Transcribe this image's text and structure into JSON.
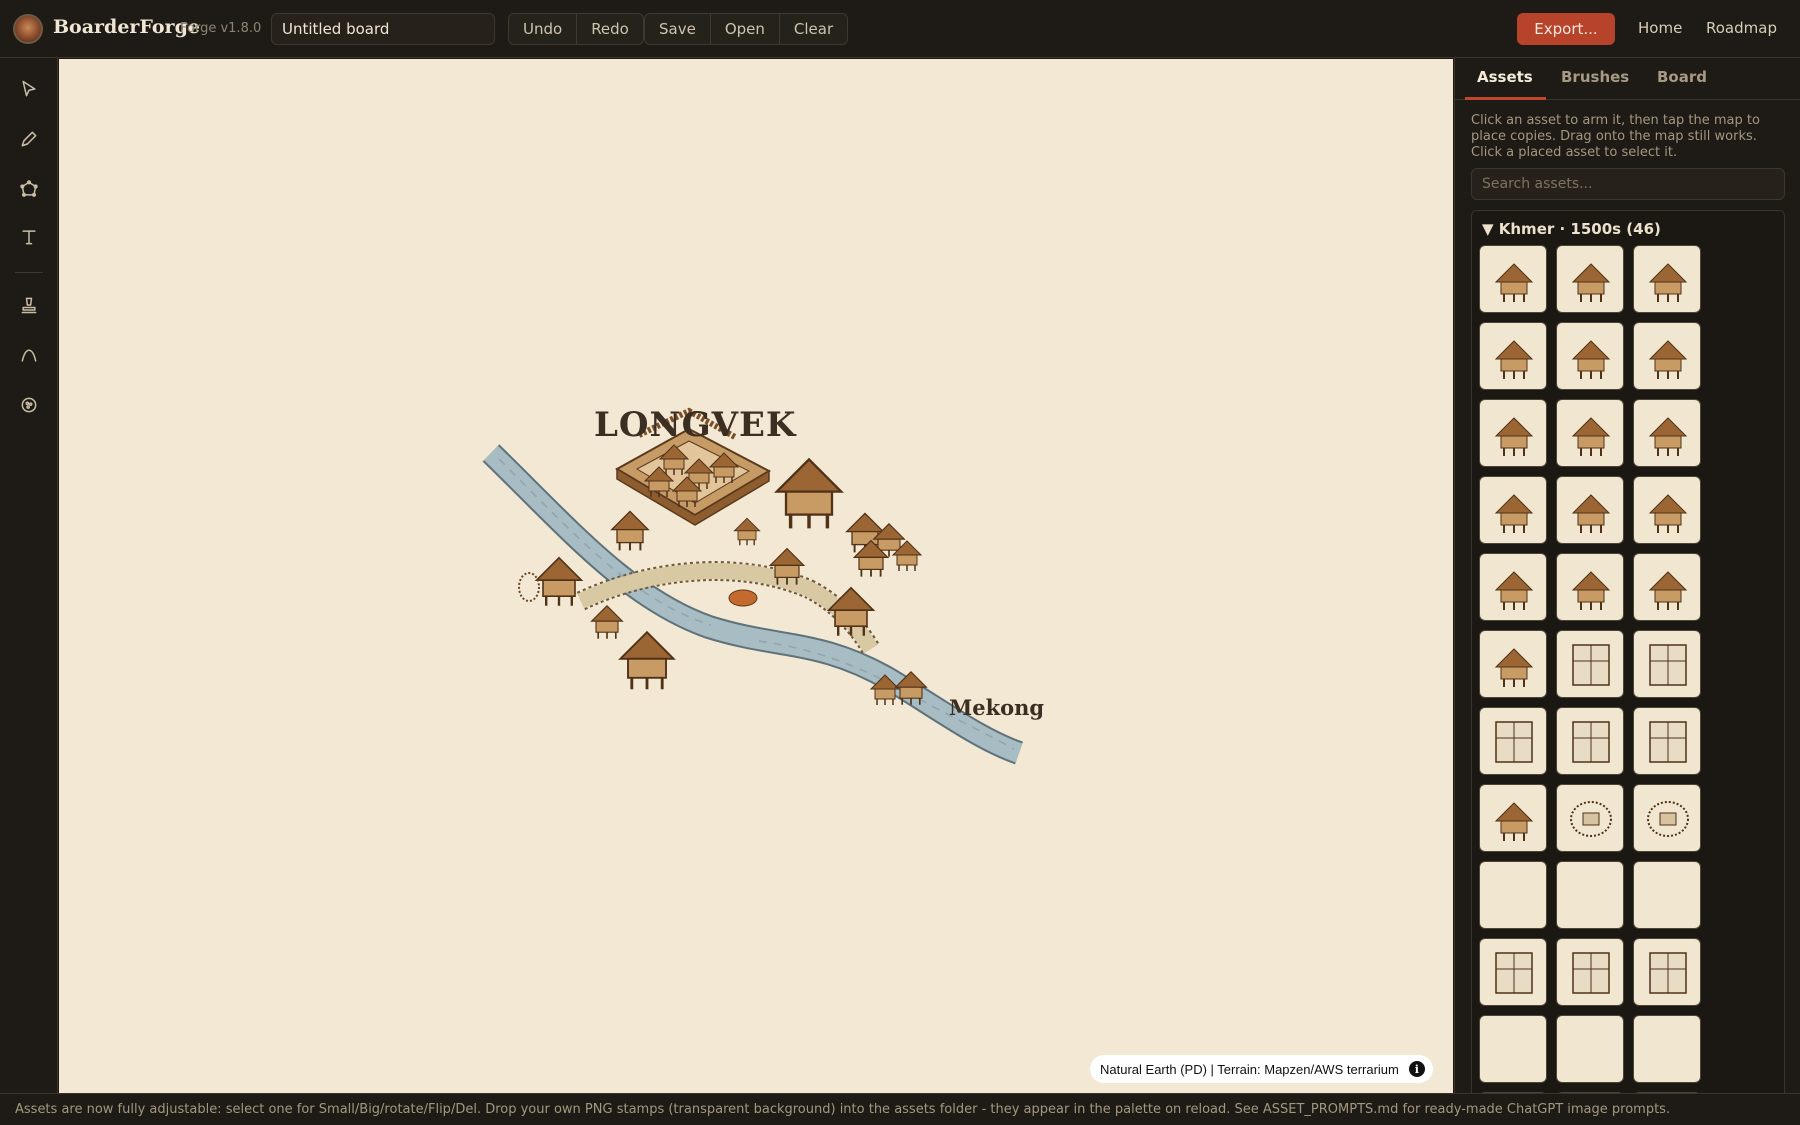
{
  "app": {
    "brand": "BoarderForge",
    "version": "Forge v1.8.0"
  },
  "header": {
    "board_title": "Untitled board",
    "undo": "Undo",
    "redo": "Redo",
    "save": "Save",
    "open": "Open",
    "clear": "Clear",
    "export": "Export...",
    "home": "Home",
    "roadmap": "Roadmap"
  },
  "toolbar": {
    "tools": [
      "select-pointer-icon",
      "pen-icon",
      "polygon-icon",
      "text-icon",
      "stamp-icon",
      "curve-icon",
      "palette-icon"
    ]
  },
  "map": {
    "city_label": "LONGVEK",
    "river_label": "Mekong",
    "attribution": "Natural Earth (PD) | Terrain: Mapzen/AWS terrarium",
    "info": "i",
    "colors": {
      "paper": "#f2e8d3",
      "river": "#a8bcc4",
      "road": "#d9c9a3",
      "wood": "#b07a48"
    }
  },
  "panel": {
    "tabs": [
      "Assets",
      "Brushes",
      "Board"
    ],
    "active_tab": "Assets",
    "help": "Click an asset to arm it, then tap the map to place copies. Drag onto the map still works. Click a placed asset to select it.",
    "search_placeholder": "Search assets...",
    "section_title": "▼ Khmer · 1500s (46)"
  },
  "status": {
    "message": "Assets are now fully adjustable: select one for Small/Big/rotate/Flip/Del. Drop your own PNG stamps (transparent background) into the assets folder - they appear in the palette on reload. See ASSET_PROMPTS.md for ready-made ChatGPT image prompts."
  }
}
